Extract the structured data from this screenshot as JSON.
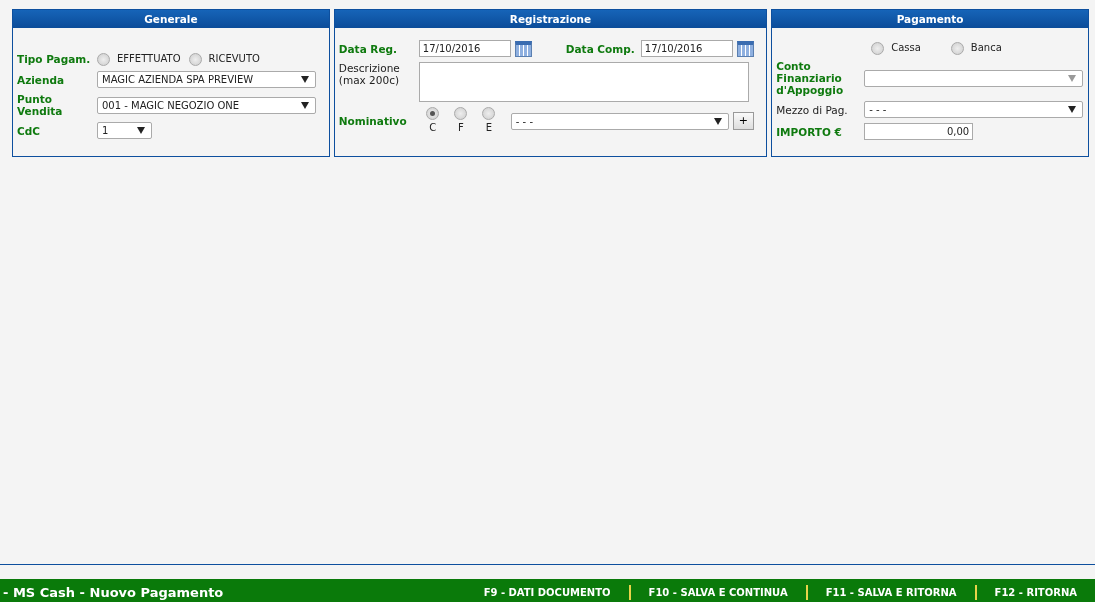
{
  "panels": [
    {
      "title": "Generale",
      "rows": [
        {
          "kind": "radio",
          "label": "Tipo Pagam.",
          "highlighted": true,
          "options": [
            {
              "label": "EFFETTUATO",
              "selected": false
            },
            {
              "label": "RICEVUTO",
              "selected": false
            }
          ]
        },
        {
          "kind": "select",
          "label": "Azienda",
          "highlighted": true,
          "value": "MAGIC AZIENDA SPA PREVIEW",
          "disabled": false
        },
        {
          "kind": "select",
          "label": "Punto Vendita",
          "highlighted": true,
          "value": "001 - MAGIC NEGOZIO ONE",
          "disabled": false
        },
        {
          "kind": "short-select",
          "label": "CdC",
          "highlighted": true,
          "value": "1",
          "disabled": false
        }
      ]
    },
    {
      "title": "Registrazione",
      "rows": [
        {
          "kind": "dates",
          "items": [
            {
              "label": "Data Reg.",
              "highlighted": true,
              "value": "17/10/2016"
            },
            {
              "label": "Data Comp.",
              "highlighted": true,
              "value": "17/10/2016"
            }
          ]
        },
        {
          "kind": "textarea",
          "label": "Descrizione (max 200c)",
          "highlighted": false
        },
        {
          "kind": "nominativo",
          "label": "Nominativo",
          "highlighted": true,
          "options": [
            {
              "label": "C",
              "selected": true
            },
            {
              "label": "F",
              "selected": false
            },
            {
              "label": "E",
              "selected": false
            }
          ],
          "value": "- - -",
          "button": "+"
        }
      ]
    },
    {
      "title": "Pagamento",
      "rows": [
        {
          "kind": "radio",
          "options": [
            {
              "label": "Cassa",
              "selected": false
            },
            {
              "label": "Banca",
              "selected": false
            }
          ]
        },
        {
          "kind": "select",
          "label": "Conto Finanziario d'Appoggio",
          "highlighted": true,
          "value": "",
          "disabled": true
        },
        {
          "kind": "select",
          "label": "Mezzo di Pag.",
          "highlighted": false,
          "value": "- - -",
          "disabled": false
        },
        {
          "kind": "amount",
          "label": "IMPORTO €",
          "highlighted": true,
          "value": "0,00"
        }
      ]
    }
  ],
  "footer": {
    "title": "- MS Cash - Nuovo Pagamento",
    "shortcuts": [
      "F9 - DATI DOCUMENTO",
      "F10 - SALVA E CONTINUA",
      "F11 - SALVA E RITORNA",
      "F12 - RITORNA"
    ]
  }
}
